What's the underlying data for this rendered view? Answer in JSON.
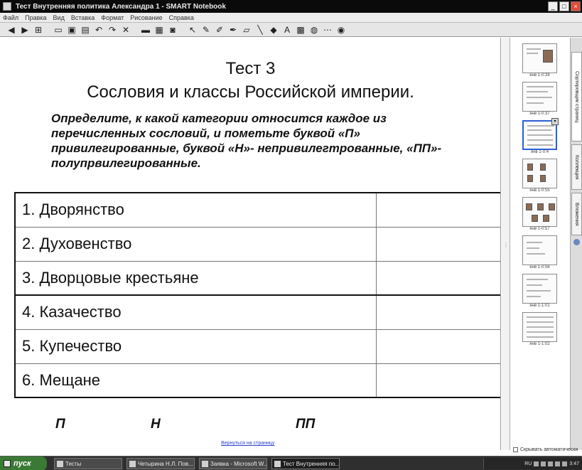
{
  "window": {
    "title": "Тест Внутренняя политика Александра 1 - SMART Notebook",
    "buttons": {
      "minimize": "_",
      "maximize": "□",
      "close": "×"
    }
  },
  "menu": [
    "Файл",
    "Правка",
    "Вид",
    "Вставка",
    "Формат",
    "Рисование",
    "Справка"
  ],
  "toolbar": [
    "prev-page-icon",
    "next-page-icon",
    "add-page-icon",
    "open-icon",
    "save-icon",
    "paste-icon",
    "undo-icon",
    "redo-icon",
    "delete-icon",
    "screen-shade-icon",
    "full-screen-icon",
    "capture-icon",
    "select-icon",
    "pen-icon",
    "highlighter-icon",
    "creative-pen-icon",
    "eraser-icon",
    "line-icon",
    "shapes-icon",
    "text-icon",
    "fill-icon",
    "table-icon",
    "toolbar-options-icon",
    "help-icon"
  ],
  "slide": {
    "title": "Тест 3",
    "subtitle": "Сословия и классы Российской империи.",
    "instructions": "Определите, к какой категории относится каждое из перечисленных сословий, и пометьте буквой «П» привилегированные, буквой «Н»- непривилегтрованные, «ПП»- полупрвилегированные.",
    "rows": [
      {
        "label": "1. Дворянство",
        "answer": ""
      },
      {
        "label": "2. Духовенство",
        "answer": ""
      },
      {
        "label": "3. Дворцовые крестьяне",
        "answer": ""
      },
      {
        "label": "4. Казачество",
        "answer": ""
      },
      {
        "label": "5. Купечество",
        "answer": ""
      },
      {
        "label": "6. Мещане",
        "answer": ""
      }
    ],
    "legend": {
      "p": "П",
      "n": "Н",
      "pp": "ПП"
    },
    "link": "Вернуться на страницу"
  },
  "sorter": {
    "thumbnails": [
      {
        "label": "янв 1-0:38"
      },
      {
        "label": "янв 1-0:37"
      },
      {
        "label": "янв 1-0:4"
      },
      {
        "label": "янв 1-0:55"
      },
      {
        "label": "янв 1-0:57"
      },
      {
        "label": "янв 1-0:56"
      },
      {
        "label": "янв 1-1:01"
      },
      {
        "label": "янв 1-1:02"
      }
    ],
    "menu_glyph": "▾",
    "auto_hide": "Скрывать автоматически"
  },
  "sidetabs": [
    "Сортировщик страниц",
    "Коллекция",
    "Вложения"
  ],
  "taskbar": {
    "start": "пуск",
    "buttons": [
      {
        "label": "Тесты",
        "active": false
      },
      {
        "label": "Четырина Н.Л. Пов...",
        "active": false
      },
      {
        "label": "Заявка - Microsoft W...",
        "active": false
      },
      {
        "label": "Тест Внутренняя по...",
        "active": true
      }
    ],
    "tray": {
      "lang": "RU",
      "time": "3:47"
    }
  }
}
